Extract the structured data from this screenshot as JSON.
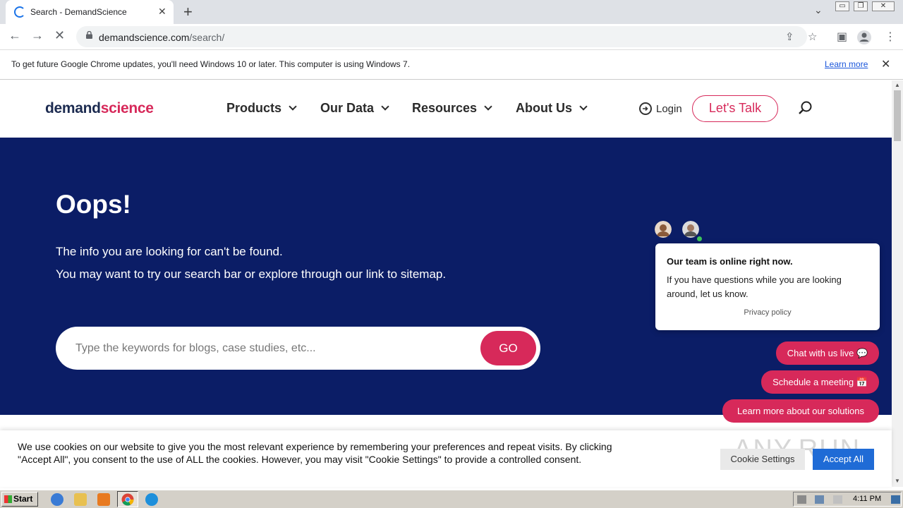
{
  "browser": {
    "tab_title": "Search - DemandScience",
    "tab_close": "✕",
    "new_tab": "+",
    "url_host": "demandscience.com",
    "url_path": "/search/",
    "info_message": "To get future Google Chrome updates, you'll need Windows 10 or later. This computer is using Windows 7.",
    "info_link": "Learn more",
    "info_close": "✕"
  },
  "header": {
    "logo_part1": "demand",
    "logo_part2": "science",
    "nav": [
      {
        "label": "Products"
      },
      {
        "label": "Our Data"
      },
      {
        "label": "Resources"
      },
      {
        "label": "About Us"
      }
    ],
    "login_label": "Login",
    "cta_label": "Let's Talk"
  },
  "hero": {
    "title": "Oops!",
    "line1": "The info you are looking for can't be found.",
    "line2": "You may want to try our search bar or explore through our link to sitemap.",
    "search_placeholder": "Type the keywords for blogs, case studies, etc...",
    "go_label": "GO"
  },
  "chat": {
    "heading": "Our team is online right now.",
    "body": "If you have questions while you are looking around, let us know.",
    "privacy": "Privacy policy",
    "actions": [
      {
        "label": "Chat with us live 💬"
      },
      {
        "label": "Schedule a meeting 📅"
      },
      {
        "label": "Learn more about our solutions"
      }
    ]
  },
  "cookie": {
    "text": "We use cookies on our website to give you the most relevant experience by remembering your preferences and repeat visits. By clicking \"Accept All\", you consent to the use of ALL the cookies. However, you may visit \"Cookie Settings\" to provide a controlled consent.",
    "settings_label": "Cookie Settings",
    "accept_label": "Accept All",
    "watermark": "ANY.RUN"
  },
  "taskbar": {
    "start_label": "Start",
    "clock": "4:11 PM"
  },
  "colors": {
    "brand_navy": "#0b1d66",
    "brand_pink": "#d7295a",
    "accept_blue": "#1f6bd6"
  }
}
